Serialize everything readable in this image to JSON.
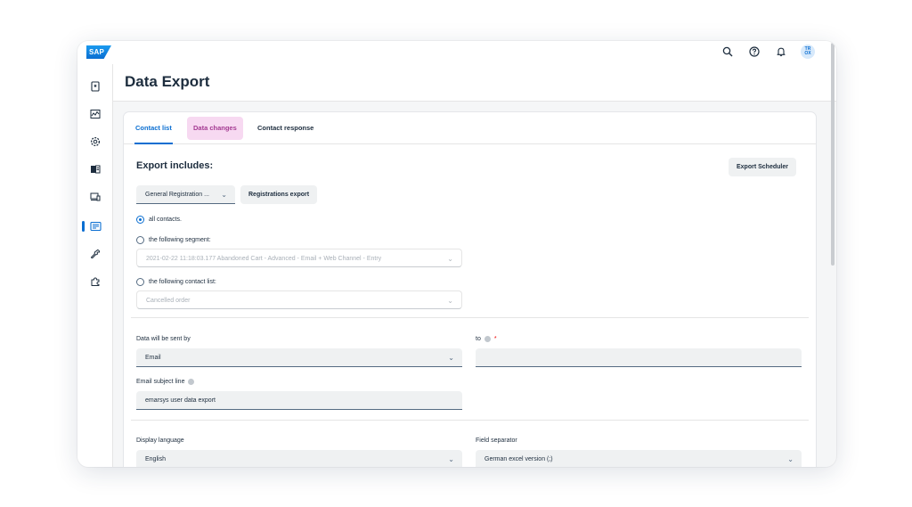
{
  "app": {
    "logo_text": "SAP",
    "user_initials": "TR\nOX",
    "page_title": "Data Export"
  },
  "tabs": [
    {
      "label": "Contact list"
    },
    {
      "label": "Data changes"
    },
    {
      "label": "Contact response"
    }
  ],
  "export": {
    "title": "Export includes:",
    "scheduler_button": "Export Scheduler",
    "type_select": "General Registration ...",
    "registrations_button": "Registrations export",
    "radio_all": "all contacts.",
    "radio_segment": "the following segment:",
    "segment_value": "2021-02-22 11:18:03.177 Abandoned Cart - Advanced - Email + Web Channel - Entry",
    "radio_contact_list": "the following contact list:",
    "contact_list_value": "Cancelled order"
  },
  "delivery": {
    "sent_by_label": "Data will be sent by",
    "sent_by_value": "Email",
    "to_label": "to",
    "required_mark": "*",
    "to_value": "",
    "subject_label": "Email subject line",
    "subject_value": "emarsys user data export"
  },
  "format": {
    "language_label": "Display language",
    "language_value": "English",
    "separator_label": "Field separator",
    "separator_value": "German excel version (;)"
  },
  "colors": {
    "accent": "#0a6ed1",
    "tab_highlight": "#f7d9f1"
  }
}
